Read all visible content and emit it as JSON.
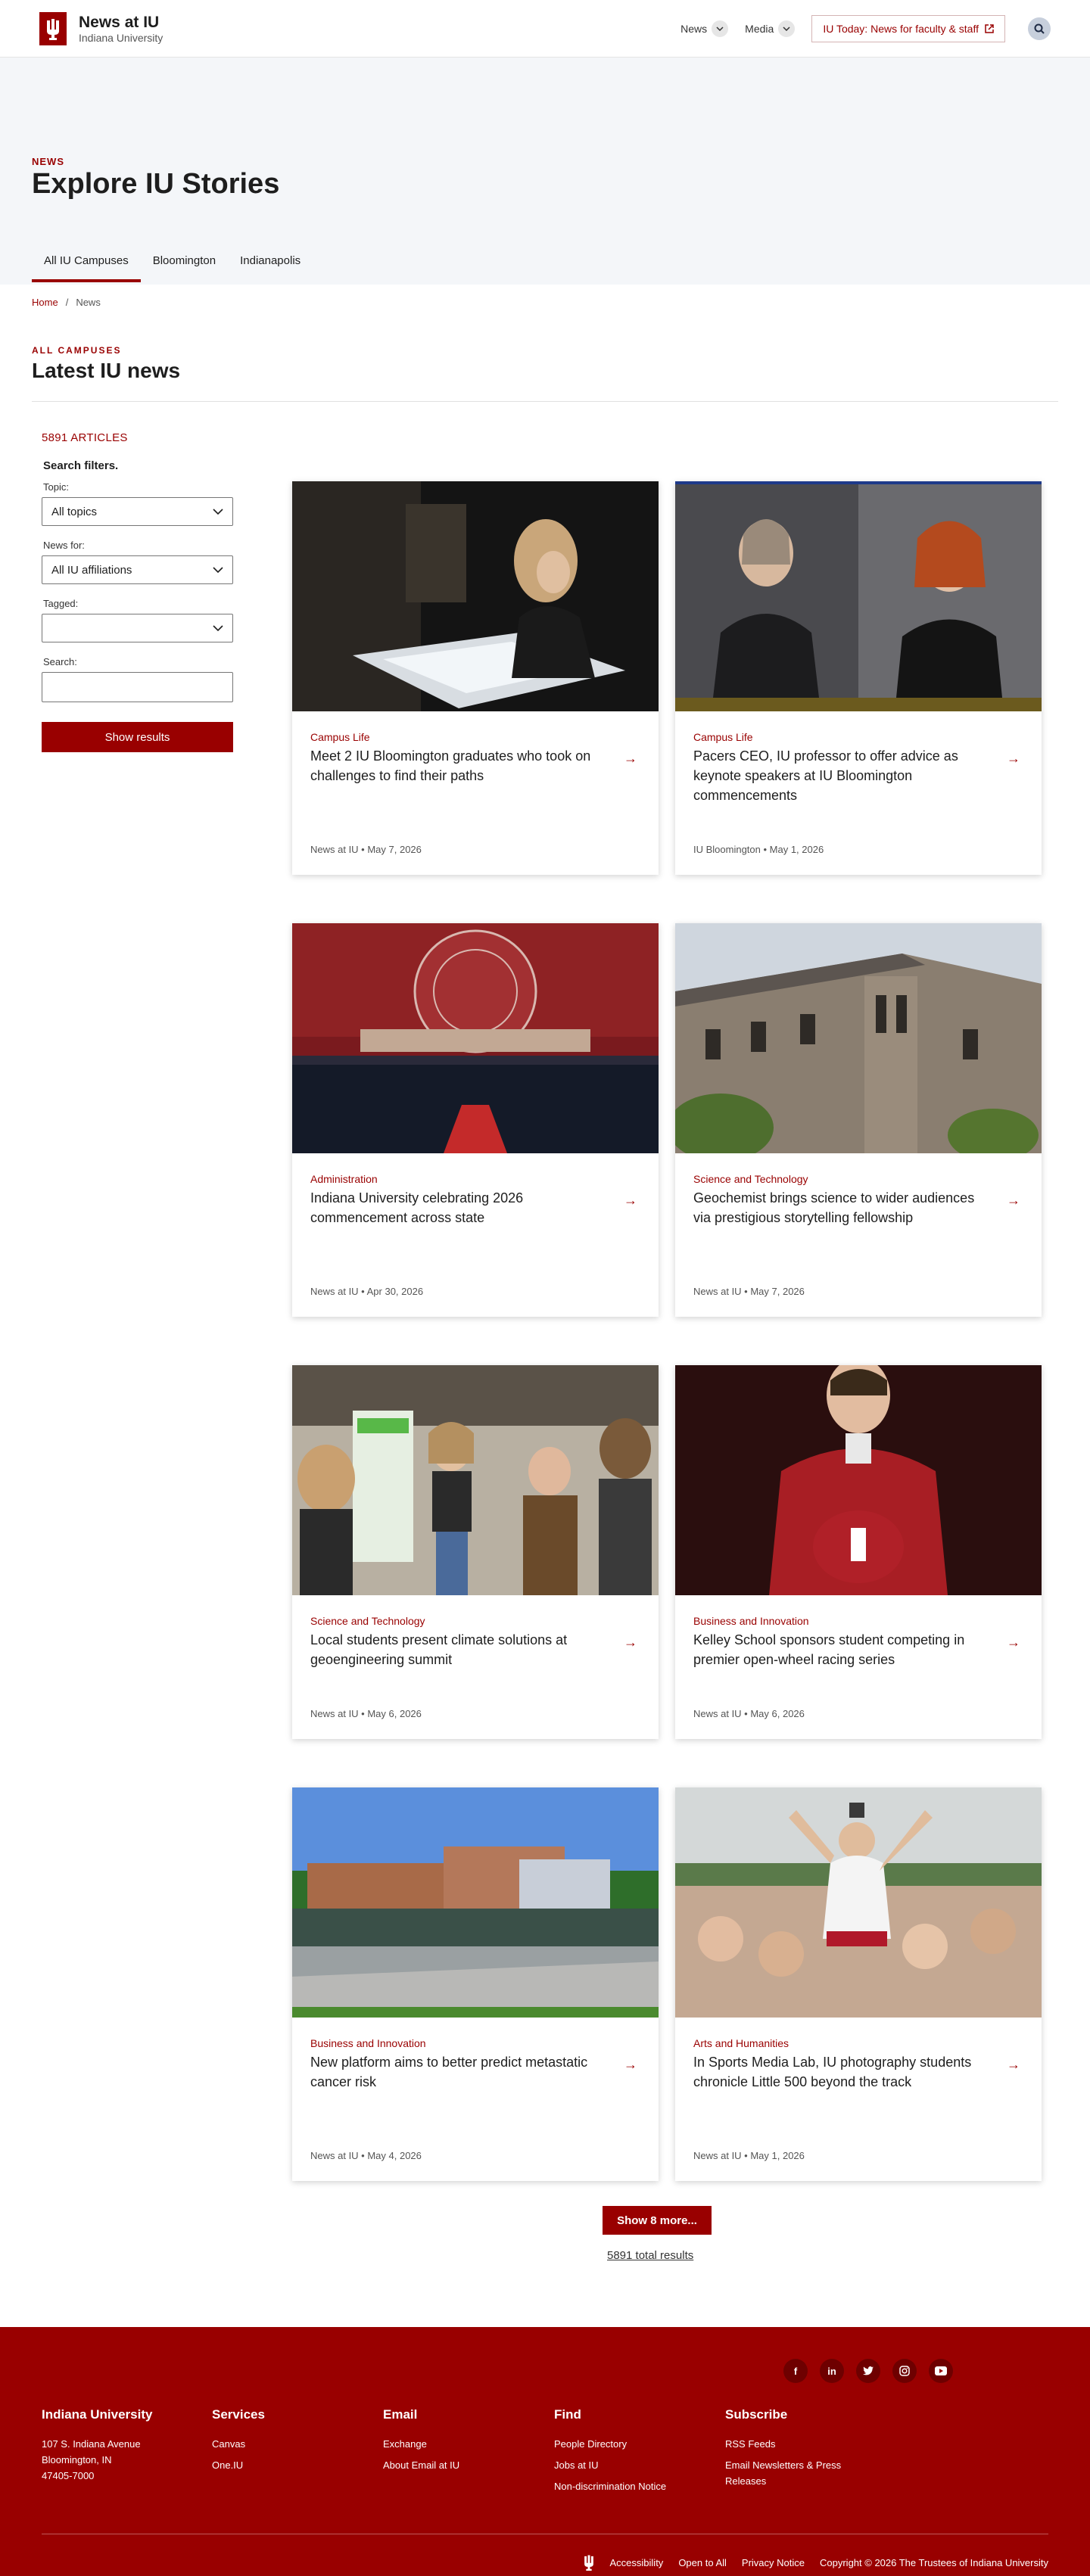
{
  "header": {
    "title": "News at IU",
    "subtitle": "Indiana University",
    "nav": [
      {
        "label": "News"
      },
      {
        "label": "Media"
      }
    ],
    "external_button": "IU Today: News for faculty & staff"
  },
  "hero": {
    "kicker": "NEWS",
    "title": "Explore IU Stories",
    "tabs": [
      "All IU Campuses",
      "Bloomington",
      "Indianapolis"
    ]
  },
  "breadcrumb": [
    "Home",
    "News"
  ],
  "section": {
    "kicker": "ALL CAMPUSES",
    "title": "Latest IU news"
  },
  "filters": {
    "count": "5891 ARTICLES",
    "title": "Search filters.",
    "topic_label": "Topic:",
    "topic_value": "All topics",
    "news_for_label": "News for:",
    "news_for_value": "All IU affiliations",
    "tagged_label": "Tagged:",
    "tagged_value": "",
    "search_label": "Search:",
    "search_value": "",
    "button": "Show results"
  },
  "articles": [
    {
      "category": "Campus Life",
      "title": "Meet 2 IU Bloomington graduates who took on challenges to find their paths",
      "meta": "News at IU • May 7, 2026"
    },
    {
      "category": "Campus Life",
      "title": "Pacers CEO, IU professor to offer advice as keynote speakers at IU Bloomington commencements",
      "meta": "IU Bloomington • May 1, 2026"
    },
    {
      "category": "Administration",
      "title": "Indiana University celebrating 2026 commencement across state",
      "meta": "News at IU • Apr 30, 2026"
    },
    {
      "category": "Science and Technology",
      "title": "Geochemist brings science to wider audiences via prestigious storytelling fellowship",
      "meta": "News at IU • May 7, 2026"
    },
    {
      "category": "Science and Technology",
      "title": "Local students present climate solutions at geoengineering summit",
      "meta": "News at IU • May 6, 2026"
    },
    {
      "category": "Business and Innovation",
      "title": "Kelley School sponsors student competing in premier open-wheel racing series",
      "meta": "News at IU • May 6, 2026"
    },
    {
      "category": "Business and Innovation",
      "title": "New platform aims to better predict metastatic cancer risk",
      "meta": "News at IU • May 4, 2026"
    },
    {
      "category": "Arts and Humanities",
      "title": "In Sports Media Lab, IU photography students chronicle Little 500 beyond the track",
      "meta": "News at IU • May 1, 2026"
    }
  ],
  "more": {
    "button": "Show 8 more...",
    "total": "5891 total results"
  },
  "footer": {
    "social": [
      "f",
      "in",
      "t",
      "ig",
      "yt"
    ],
    "columns": [
      {
        "heading": "Indiana University",
        "lines": [
          "107 S. Indiana Avenue",
          "Bloomington, IN",
          "47405-7000"
        ]
      },
      {
        "heading": "Services",
        "lines": [
          "Canvas",
          "One.IU"
        ]
      },
      {
        "heading": "Email",
        "lines": [
          "Exchange",
          "About Email at IU"
        ]
      },
      {
        "heading": "Find",
        "lines": [
          "People Directory",
          "Jobs at IU",
          "Non-discrimination Notice"
        ]
      },
      {
        "heading": "Subscribe",
        "lines": [
          "RSS Feeds",
          "Email Newsletters & Press Releases"
        ]
      }
    ],
    "bottom_links": [
      "Accessibility",
      "Open to All",
      "Privacy Notice",
      "Copyright © 2026 The Trustees of Indiana University"
    ]
  },
  "colors": {
    "brand": "#990000",
    "hero_bg": "#f4f6f9"
  }
}
